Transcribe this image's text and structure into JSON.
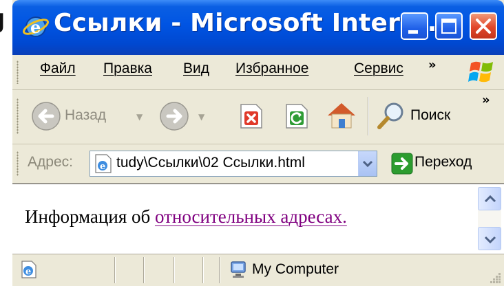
{
  "background_letter": "J",
  "window": {
    "title": "Ссылки - Microsoft Intern...",
    "colors": {
      "title_bar": "#0054e3",
      "close_button": "#e1472a",
      "chrome": "#ece9d8"
    }
  },
  "menu": {
    "items": [
      {
        "label": "Файл",
        "name": "file"
      },
      {
        "label": "Правка",
        "name": "edit"
      },
      {
        "label": "Вид",
        "name": "view"
      },
      {
        "label": "Избранное",
        "name": "favorites"
      },
      {
        "label": "Сервис",
        "name": "tools"
      }
    ],
    "overflow": "»"
  },
  "toolbar": {
    "back_label": "Назад",
    "search_label": "Поиск",
    "overflow": "»",
    "icons": [
      "back-arrow-icon",
      "forward-arrow-icon",
      "stop-icon",
      "refresh-icon",
      "home-icon",
      "search-icon"
    ]
  },
  "address": {
    "label": "Адрес:",
    "value": "tudy\\Ссылки\\02 Ссылки.html",
    "go_label": "Переход"
  },
  "content": {
    "text_before": "Информация об ",
    "link_text": "относительных адресах.",
    "link_color": "#800080"
  },
  "status": {
    "zone": "My Computer"
  }
}
